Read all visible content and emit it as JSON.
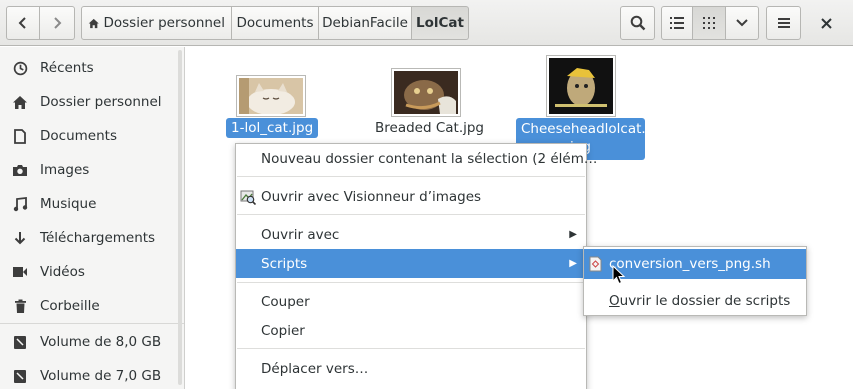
{
  "nav": {
    "back_icon": "chevron-left-icon",
    "forward_icon": "chevron-right-icon"
  },
  "breadcrumb": [
    {
      "label": "Dossier personnel",
      "icon": "home-icon"
    },
    {
      "label": "Documents"
    },
    {
      "label": "DebianFacile"
    },
    {
      "label": "LolCat"
    }
  ],
  "toolbar": {
    "search_icon": "search-icon",
    "list_view_icon": "list-icon",
    "grid_view_icon": "grid-icon",
    "view_options_icon": "chevron-down-icon",
    "menu_icon": "hamburger-icon",
    "close_icon": "close-icon"
  },
  "sidebar": {
    "items": [
      {
        "label": "Récents",
        "icon": "clock-icon"
      },
      {
        "label": "Dossier personnel",
        "icon": "home-icon"
      },
      {
        "label": "Documents",
        "icon": "document-icon"
      },
      {
        "label": "Images",
        "icon": "camera-icon"
      },
      {
        "label": "Musique",
        "icon": "music-icon"
      },
      {
        "label": "Téléchargements",
        "icon": "download-icon"
      },
      {
        "label": "Vidéos",
        "icon": "video-icon"
      },
      {
        "label": "Corbeille",
        "icon": "trash-icon"
      }
    ],
    "volumes": [
      {
        "label": "Volume de 8,0 GB",
        "icon": "drive-icon"
      },
      {
        "label": "Volume de 7,0 GB",
        "icon": "drive-icon"
      }
    ]
  },
  "files": [
    {
      "name": "1-lol_cat.jpg",
      "selected": true
    },
    {
      "name": "Breaded Cat.jpg",
      "selected": false
    },
    {
      "name_line1": "Cheeseheadlolcat.",
      "name_line2": "jpg",
      "selected": true
    }
  ],
  "context_menu": {
    "new_folder": "Nouveau dossier contenant la sélection (2 élém…",
    "open_with_viewer": "Ouvrir avec Visionneur d’images",
    "open_with": "Ouvrir avec",
    "scripts": "Scripts",
    "cut": "Couper",
    "copy": "Copier",
    "move_to": "Déplacer vers…"
  },
  "scripts_submenu": {
    "script_file": "conversion_vers_png.sh",
    "open_scripts_folder_first": "O",
    "open_scripts_folder_rest": "uvrir le dossier de scripts"
  },
  "colors": {
    "selection": "#4a90d9"
  }
}
